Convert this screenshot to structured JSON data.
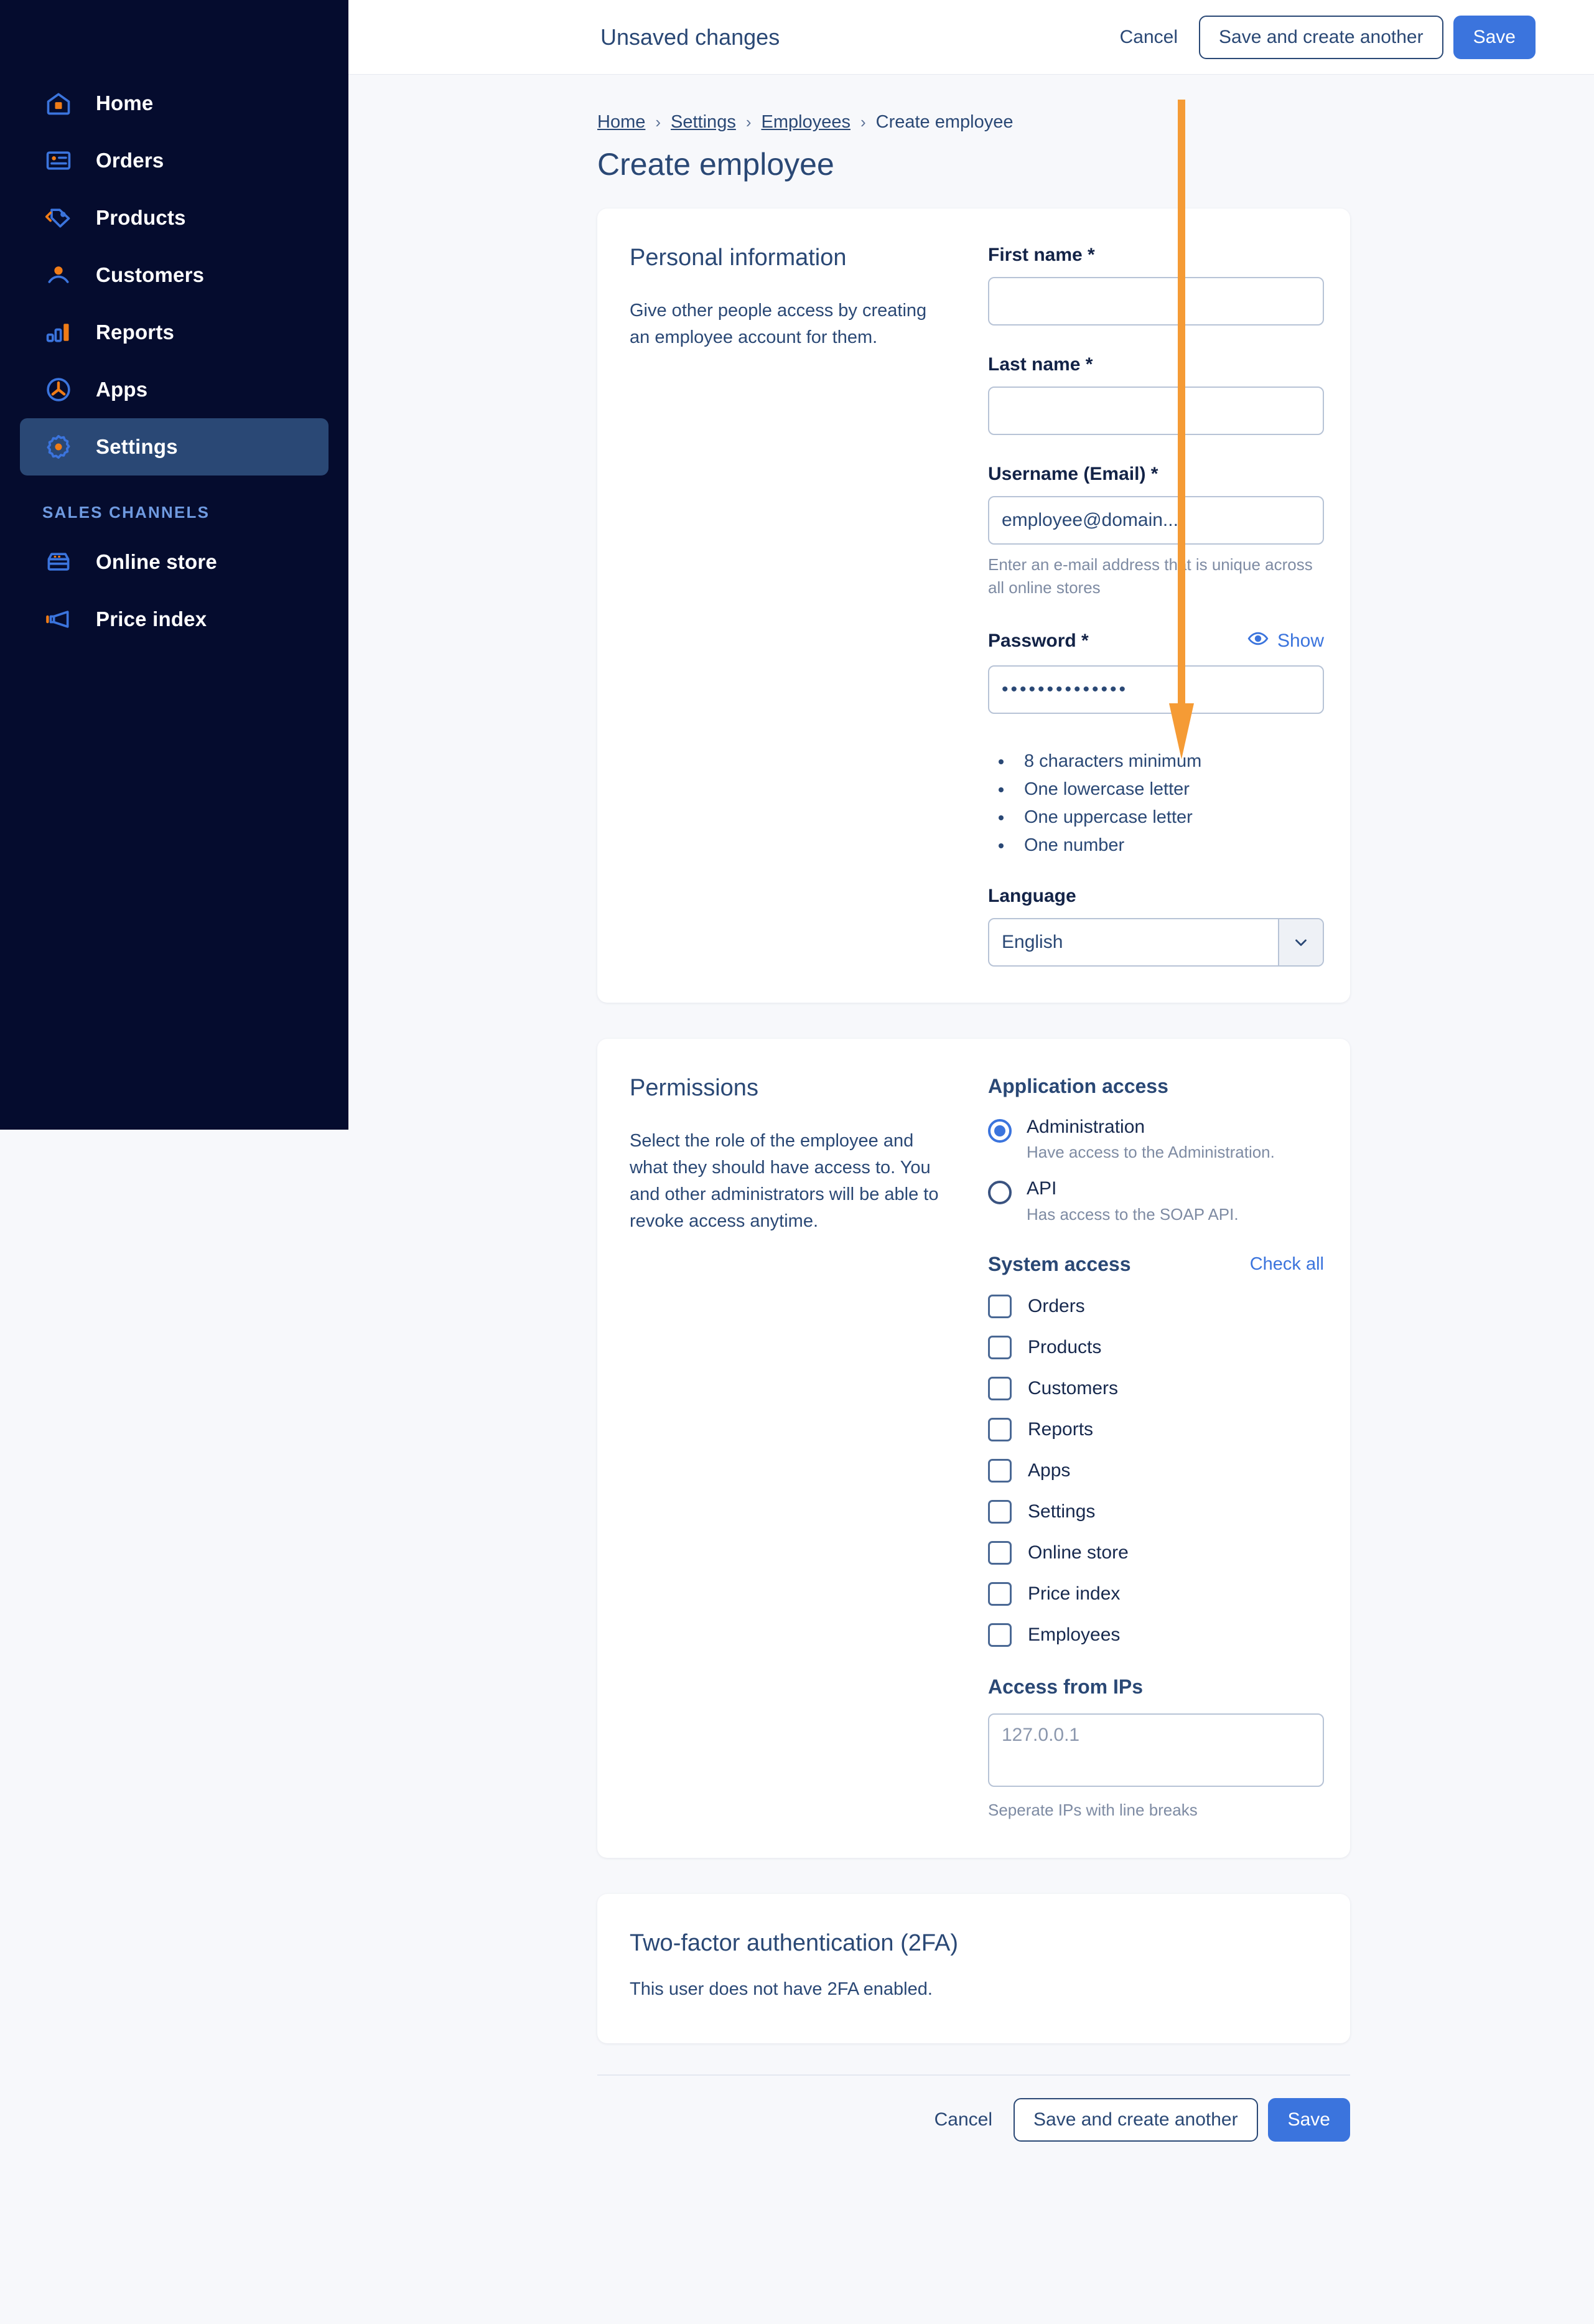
{
  "sidebar": {
    "items": [
      {
        "label": "Home",
        "icon": "home-icon",
        "active": false
      },
      {
        "label": "Orders",
        "icon": "orders-icon",
        "active": false
      },
      {
        "label": "Products",
        "icon": "tag-icon",
        "active": false
      },
      {
        "label": "Customers",
        "icon": "customers-icon",
        "active": false
      },
      {
        "label": "Reports",
        "icon": "bar-chart-icon",
        "active": false
      },
      {
        "label": "Apps",
        "icon": "apps-icon",
        "active": false
      },
      {
        "label": "Settings",
        "icon": "gear-icon",
        "active": true
      }
    ],
    "section_label": "SALES CHANNELS",
    "channels": [
      {
        "label": "Online store",
        "icon": "store-icon"
      },
      {
        "label": "Price index",
        "icon": "megaphone-icon"
      }
    ]
  },
  "topbar": {
    "status": "Unsaved changes",
    "cancel_label": "Cancel",
    "save_another_label": "Save and create another",
    "save_label": "Save"
  },
  "breadcrumb": {
    "home": "Home",
    "settings": "Settings",
    "employees": "Employees",
    "current": "Create employee",
    "separator": "›"
  },
  "page_title": "Create employee",
  "personal_information": {
    "title": "Personal information",
    "description": "Give other people access by creating an employee account for them.",
    "first_name": {
      "label": "First name *",
      "value": "",
      "placeholder": ""
    },
    "last_name": {
      "label": "Last name *",
      "value": "",
      "placeholder": ""
    },
    "username": {
      "label": "Username (Email) *",
      "placeholder": "employee@domain....",
      "value": "",
      "help": "Enter an e-mail address that is unique across all online stores"
    },
    "password": {
      "label": "Password *",
      "show_label": "Show",
      "show_icon": "eye-icon",
      "value": "••••••••••••••"
    },
    "requirements": [
      "8 characters minimum",
      "One lowercase letter",
      "One uppercase letter",
      "One number"
    ],
    "language": {
      "label": "Language",
      "value": "English",
      "options": [
        "English"
      ]
    }
  },
  "permissions": {
    "title": "Permissions",
    "description": "Select the role of the employee and what they should have access to. You and other administrators will be able to revoke access anytime.",
    "application_access": {
      "title": "Application access",
      "options": [
        {
          "label": "Administration",
          "description": "Have access to the Administration.",
          "selected": true
        },
        {
          "label": "API",
          "description": "Has access to the SOAP API.",
          "selected": false
        }
      ]
    },
    "system_access": {
      "title": "System access",
      "check_all_label": "Check all",
      "items": [
        {
          "label": "Orders",
          "checked": false
        },
        {
          "label": "Products",
          "checked": false
        },
        {
          "label": "Customers",
          "checked": false
        },
        {
          "label": "Reports",
          "checked": false
        },
        {
          "label": "Apps",
          "checked": false
        },
        {
          "label": "Settings",
          "checked": false
        },
        {
          "label": "Online store",
          "checked": false
        },
        {
          "label": "Price index",
          "checked": false
        },
        {
          "label": "Employees",
          "checked": false
        }
      ]
    },
    "access_ips": {
      "title": "Access from IPs",
      "placeholder": "127.0.0.1",
      "value": "",
      "help": "Seperate IPs with line breaks"
    }
  },
  "two_factor": {
    "title": "Two-factor authentication (2FA)",
    "text": "This user does not have 2FA enabled."
  },
  "bottom_actions": {
    "cancel_label": "Cancel",
    "save_another_label": "Save and create another",
    "save_label": "Save"
  },
  "annotation": {
    "type": "arrow-down",
    "color": "#f59b35",
    "points_to": "password-input"
  },
  "colors": {
    "sidebar_bg": "#050c2e",
    "sidebar_active": "#2a4875",
    "accent_blue": "#3b74dd",
    "accent_orange": "#f07c17",
    "text_navy": "#2a4875",
    "page_bg": "#f7f8fb",
    "annotation_orange": "#f59b35"
  }
}
